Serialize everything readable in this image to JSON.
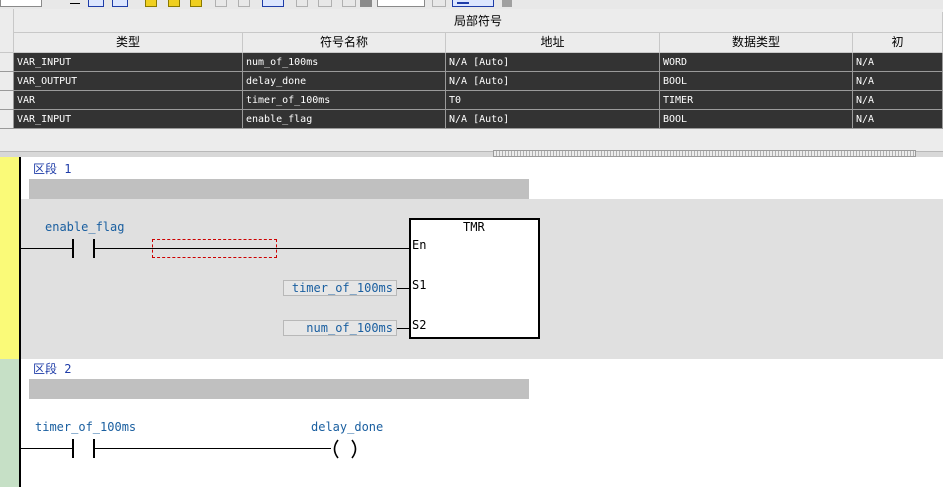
{
  "table": {
    "group_header": "局部符号",
    "columns": [
      "类型",
      "符号名称",
      "地址",
      "数据类型",
      "初"
    ],
    "rows": [
      [
        "VAR_INPUT",
        "num_of_100ms",
        "N/A [Auto]",
        "WORD",
        "N/A"
      ],
      [
        "VAR_OUTPUT",
        "delay_done",
        "N/A [Auto]",
        "BOOL",
        "N/A"
      ],
      [
        "VAR",
        "timer_of_100ms",
        "T0",
        "TIMER",
        "N/A"
      ],
      [
        "VAR_INPUT",
        "enable_flag",
        "N/A [Auto]",
        "BOOL",
        "N/A"
      ]
    ]
  },
  "ladder": {
    "sections": [
      {
        "title": "区段 1",
        "contact_label": "enable_flag",
        "block": {
          "name": "TMR",
          "pins": [
            "En",
            "S1",
            "S2"
          ],
          "s1_value": "timer_of_100ms",
          "s2_value": "num_of_100ms"
        }
      },
      {
        "title": "区段 2",
        "contact_label": "timer_of_100ms",
        "coil_label": "delay_done"
      }
    ]
  },
  "colors": {
    "row_bg": "#333333",
    "section1_gutter": "#fafa78",
    "section2_gutter": "#c6e0c6",
    "section1_bg": "#e0e0e0",
    "label_blue": "#1a5fa0",
    "title_blue": "#1e3ca8",
    "selection_red": "#cc0000"
  }
}
